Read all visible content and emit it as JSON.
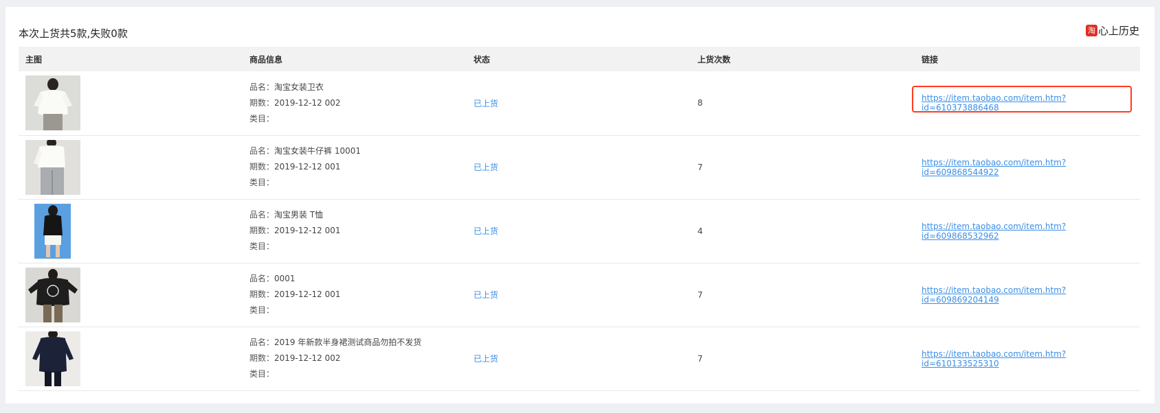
{
  "title": "本次上货共5款,失败0款",
  "brand": {
    "icon": "淘",
    "label": "心上历史"
  },
  "table": {
    "headers": [
      "主图",
      "商品信息",
      "状态",
      "上货次数",
      "链接"
    ],
    "labels": {
      "name": "品名：",
      "period": "期数：",
      "category": "类目："
    },
    "rows": [
      {
        "image": "white-blouse-woman",
        "name": "淘宝女装卫衣",
        "period": "2019-12-12 002",
        "category": "",
        "status": "已上货",
        "count": "8",
        "link": "https://item.taobao.com/item.htm?id=610373886468",
        "highlighted": true
      },
      {
        "image": "white-top-grey-pants",
        "name": "淘宝女装牛仔裤 10001",
        "period": "2019-12-12 001",
        "category": "",
        "status": "已上货",
        "count": "7",
        "link": "https://item.taobao.com/item.htm?id=609868544922",
        "highlighted": false
      },
      {
        "image": "black-tee-blue-background",
        "name": "淘宝男装 T恤",
        "period": "2019-12-12 001",
        "category": "",
        "status": "已上货",
        "count": "4",
        "link": "https://item.taobao.com/item.htm?id=609868532962",
        "highlighted": false
      },
      {
        "image": "black-sweatshirt-man",
        "name": "0001",
        "period": "2019-12-12 001",
        "category": "",
        "status": "已上货",
        "count": "7",
        "link": "https://item.taobao.com/item.htm?id=609869204149",
        "highlighted": false
      },
      {
        "image": "navy-top-woman",
        "name": "2019 年新款半身裙测试商品勿拍不发货",
        "period": "2019-12-12 002",
        "category": "",
        "status": "已上货",
        "count": "7",
        "link": "https://item.taobao.com/item.htm?id=610133525310",
        "highlighted": false
      }
    ]
  },
  "colors": {
    "accent": "#3a8ee6",
    "highlight": "#ff3b1f",
    "brand": "#e02e24"
  }
}
